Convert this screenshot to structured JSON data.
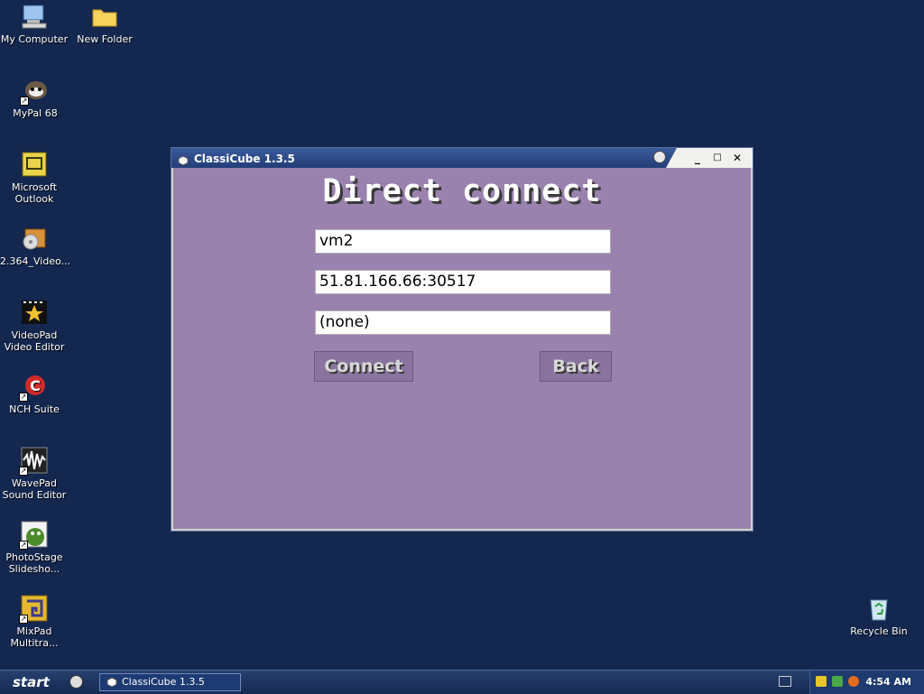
{
  "desktop": {
    "icons": [
      {
        "label": "My Computer"
      },
      {
        "label": "New Folder"
      },
      {
        "label": "MyPal 68"
      },
      {
        "label": "Microsoft Outlook"
      },
      {
        "label": "2.364_Video..."
      },
      {
        "label": "VideoPad Video Editor"
      },
      {
        "label": "NCH Suite"
      },
      {
        "label": "WavePad Sound Editor"
      },
      {
        "label": "PhotoStage Slidesho..."
      },
      {
        "label": "MixPad Multitra..."
      },
      {
        "label": "Recycle Bin"
      }
    ]
  },
  "window": {
    "title": "ClassiCube 1.3.5",
    "heading": "Direct connect",
    "fields": {
      "username": "vm2",
      "address": "51.81.166.66:30517",
      "mppass": "(none)"
    },
    "buttons": {
      "connect": "Connect",
      "back": "Back"
    }
  },
  "taskbar": {
    "start_label": "start",
    "task_label": "ClassiCube 1.3.5",
    "clock": "4:54 AM"
  },
  "colors": {
    "desktop": "#13274f",
    "window_client": "#9a82af",
    "button": "#8a749f"
  }
}
